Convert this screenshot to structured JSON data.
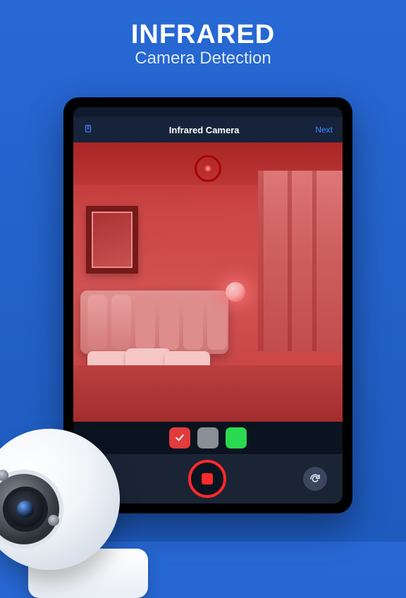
{
  "hero": {
    "title": "INFRARED",
    "subtitle": "Camera Detection"
  },
  "nav": {
    "back_icon": "document-icon",
    "title": "Infrared Camera",
    "next": "Next"
  },
  "swatches": {
    "selected": "red"
  },
  "controls": {
    "record_state": "recording"
  }
}
